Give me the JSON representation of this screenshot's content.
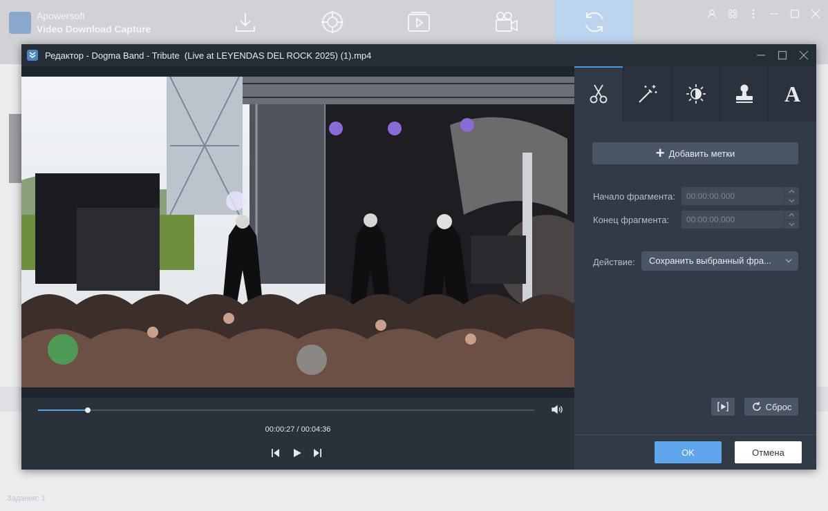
{
  "app": {
    "name_line1": "Apowersoft",
    "name_line2": "Video Download Capture",
    "nav": [
      {
        "icon": "download-icon"
      },
      {
        "icon": "target-icon"
      },
      {
        "icon": "video-player-icon"
      },
      {
        "icon": "camera-icon"
      },
      {
        "icon": "convert-icon",
        "active": true
      }
    ],
    "status": "Задания: 1"
  },
  "editor": {
    "title": "Редактор - Dogma Band - Tribute  (Live at LEYENDAS DEL ROCK 2025) (1).mp4",
    "player": {
      "time_current": "00:00:27",
      "time_separator": " / ",
      "time_total": "00:04:36",
      "progress_fraction": 0.1
    },
    "tabs": [
      {
        "icon": "scissors-icon",
        "active": true
      },
      {
        "icon": "magic-wand-icon"
      },
      {
        "icon": "brightness-icon"
      },
      {
        "icon": "stamp-icon"
      },
      {
        "icon": "text-icon",
        "glyph": "A"
      }
    ],
    "add_marks_label": "Добавить метки",
    "start_label": "Начало фрагмента:",
    "start_value": "00:00:00.000",
    "end_label": "Конец фрагмента:",
    "end_value": "00:00:00.000",
    "action_label": "Действие:",
    "action_value": "Сохранить выбранный фра...",
    "reset_label": "Сброс",
    "ok_label": "OK",
    "cancel_label": "Отмена"
  },
  "colors": {
    "accent": "#5ea5ec",
    "dialog_bg": "#262d37",
    "panel_bg": "#323a46"
  }
}
